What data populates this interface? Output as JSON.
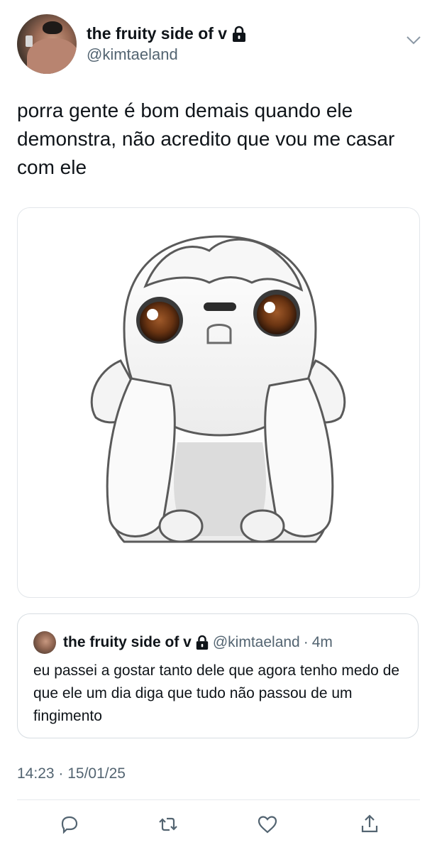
{
  "tweet": {
    "author": {
      "display_name": "the fruity side of v",
      "handle": "@kimtaeland",
      "protected_icon": "lock-icon"
    },
    "text": "porra gente é bom demais quando ele demonstra, não acredito que vou me casar com ele",
    "quoted": {
      "display_name": "the fruity side of v",
      "handle": "@kimtaeland",
      "separator": "·",
      "age": "4m",
      "text": "eu passei a gostar tanto dele que agora tenho medo de que ele um dia diga que tudo não passou de um fingimento"
    },
    "timestamp": "14:23 · 15/01/25"
  },
  "actions": [
    {
      "icon": "reply-icon"
    },
    {
      "icon": "retweet-icon"
    },
    {
      "icon": "like-icon"
    },
    {
      "icon": "share-icon"
    }
  ],
  "colors": {
    "text": "#0f1419",
    "secondary": "#536471",
    "border": "#d7dde2"
  }
}
